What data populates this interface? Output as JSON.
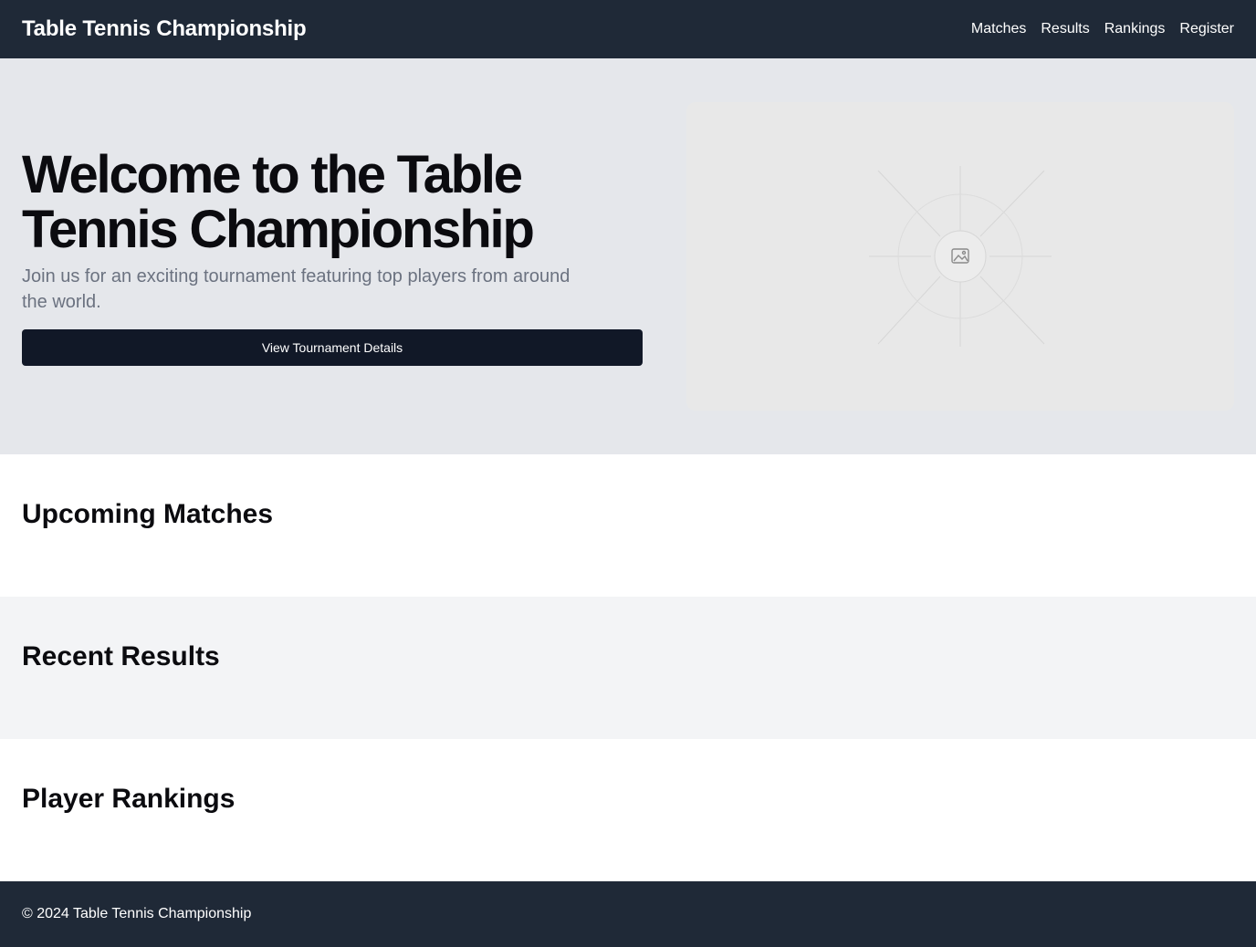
{
  "header": {
    "brand": "Table Tennis Championship",
    "nav": [
      "Matches",
      "Results",
      "Rankings",
      "Register"
    ]
  },
  "hero": {
    "title": "Welcome to the Table Tennis Championship",
    "subtitle": "Join us for an exciting tournament featuring top players from around the world.",
    "cta_label": "View Tournament Details",
    "image_icon": "image-placeholder-icon"
  },
  "sections": {
    "upcoming": "Upcoming Matches",
    "results": "Recent Results",
    "rankings": "Player Rankings"
  },
  "footer": {
    "copyright": "© 2024 Table Tennis Championship"
  },
  "colors": {
    "header_bg": "#1f2937",
    "hero_bg": "#e5e7eb",
    "button_bg": "#111827",
    "alt_section_bg": "#f3f4f6",
    "muted_text": "#6b7280"
  }
}
